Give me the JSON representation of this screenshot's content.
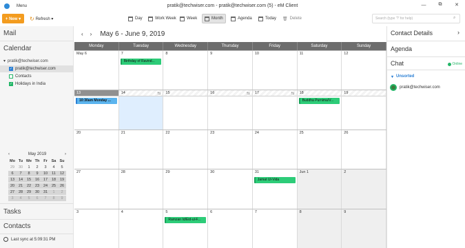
{
  "app": {
    "window_title": "pratik@techwiser.com - pratik@techwiser.com (5) - eM Client",
    "menu_label": "Menu"
  },
  "toolbar": {
    "new_label": "+ New ▾",
    "refresh_label": "Refresh ▾",
    "views": [
      {
        "label": "Day",
        "active": false
      },
      {
        "label": "Work Week",
        "active": false
      },
      {
        "label": "Week",
        "active": false
      },
      {
        "label": "Month",
        "active": true
      },
      {
        "label": "Agenda",
        "active": false
      },
      {
        "label": "Today",
        "active": false
      },
      {
        "label": "Delete",
        "active": false
      }
    ],
    "search_placeholder": "Search (type '?' for help)"
  },
  "sidebar": {
    "mail": "Mail",
    "calendar": "Calendar",
    "account": "pratik@techwiser.com",
    "calendars": [
      {
        "label": "pratik@techwiser.com"
      },
      {
        "label": "Contacts"
      },
      {
        "label": "Holidays in India"
      }
    ],
    "tasks": "Tasks",
    "contacts": "Contacts",
    "sync": "Last sync at 5:09:31 PM"
  },
  "mini_calendar": {
    "title": "May 2019",
    "prev": "‹",
    "next": "›",
    "headers": [
      "Mo",
      "Tu",
      "We",
      "Th",
      "Fr",
      "Sa",
      "Su"
    ],
    "rows": [
      [
        "29",
        "30",
        "1",
        "2",
        "3",
        "4",
        "5"
      ],
      [
        "6",
        "7",
        "8",
        "9",
        "10",
        "11",
        "12"
      ],
      [
        "13",
        "14",
        "15",
        "16",
        "17",
        "18",
        "19"
      ],
      [
        "20",
        "21",
        "22",
        "23",
        "24",
        "25",
        "26"
      ],
      [
        "27",
        "28",
        "29",
        "30",
        "31",
        "1",
        "2"
      ],
      [
        "3",
        "4",
        "5",
        "6",
        "7",
        "8",
        "9"
      ]
    ]
  },
  "calendar": {
    "range": "May 6 - June 9, 2019",
    "prev": "‹",
    "next": "›",
    "day_names": [
      "Monday",
      "Tuesday",
      "Wednesday",
      "Thursday",
      "Friday",
      "Saturday",
      "Sunday"
    ],
    "weeks": [
      [
        "May 6",
        "7",
        "8",
        "9",
        "10",
        "11",
        "12"
      ],
      [
        "13",
        "14",
        "15",
        "16",
        "17",
        "18",
        "19"
      ],
      [
        "20",
        "21",
        "22",
        "23",
        "24",
        "25",
        "26"
      ],
      [
        "27",
        "28",
        "29",
        "30",
        "31",
        "Jun 1",
        "2"
      ],
      [
        "3",
        "4",
        "5",
        "6",
        "7",
        "8",
        "9"
      ]
    ],
    "events": {
      "birthday": "Birthday of Ravind...",
      "meeting": "10:30am  Monday ...",
      "buddha": "Buddha Purnima/V...",
      "jamat": "Jamat Ul-Vida",
      "ramzan": "Ramzan Id/Eid-ul-F..."
    }
  },
  "right_panel": {
    "contact_details": "Contact Details",
    "agenda": "Agenda",
    "chat": "Chat",
    "online": "Online",
    "unsorted": "Unsorted",
    "contact": "pratik@techwiser.com"
  },
  "colors": {
    "accent_orange": "#f39c1f",
    "event_green": "#2dcc78",
    "event_blue": "#5bb4ee",
    "selection": "#2a7fd4"
  }
}
